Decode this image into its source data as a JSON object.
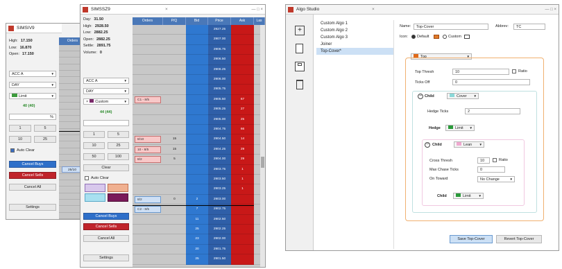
{
  "left_window": {
    "title": "SIMSIV9",
    "stats": [
      {
        "label": "High:",
        "value": "17.150"
      },
      {
        "label": "Low:",
        "value": "16.870"
      },
      {
        "label": "Open:",
        "value": "17.150"
      }
    ],
    "account": "ACC A",
    "qty_mode": "DAY",
    "order_type": "Limit",
    "qty_display": "40 (40)",
    "qty_unit": "%",
    "qty_buttons": [
      "1",
      "5",
      "10",
      "25"
    ],
    "auto_clear": "Auto Clear",
    "cancel_buys": "Cancel Buys",
    "cancel_sells": "Cancel Sells",
    "cancel_all": "Cancel All",
    "settings": "Settings",
    "col_orders": "Orders",
    "order_tag": "25/10"
  },
  "mid_window": {
    "title": "SIMSSZ9",
    "stats": [
      {
        "label": "Day:",
        "value": "31.50"
      },
      {
        "label": "High:",
        "value": "2928.50"
      },
      {
        "label": "Low:",
        "value": "2882.25"
      },
      {
        "label": "Open:",
        "value": "2882.25"
      },
      {
        "label": "Settle:",
        "value": "2891.75"
      },
      {
        "label": "Volume:",
        "value": "0"
      }
    ],
    "account": "ACC A",
    "qty_mode": "DAY",
    "custom_label": "Custom",
    "qty_display": "44 (44)",
    "qty_buttons": [
      "1",
      "5",
      "10",
      "25",
      "50",
      "100"
    ],
    "clear": "Clear",
    "auto_clear": "Auto Clear",
    "cancel_buys": "Cancel Buys",
    "cancel_sells": "Cancel Sells",
    "cancel_all": "Cancel All",
    "settings": "Settings",
    "columns": [
      "Orders",
      "P/Q",
      "Bid",
      "Price",
      "Ask",
      "Las"
    ],
    "prices": [
      "2927.25",
      "2907.00",
      "2906.75",
      "2906.50",
      "2906.25",
      "2906.00",
      "2905.75",
      "2905.50",
      "2905.25",
      "2905.00",
      "2904.75",
      "2904.50",
      "2904.25",
      "2904.00",
      "2903.75",
      "2903.50",
      "2903.25",
      "2903.00",
      "2902.75",
      "2902.50",
      "2902.25",
      "2902.00",
      "2901.75",
      "2901.50"
    ],
    "ask_values": [
      "",
      "",
      "",
      "",
      "",
      "",
      "",
      "67",
      "27",
      "25",
      "66",
      "14",
      "29",
      "29",
      "1",
      "1",
      "1",
      "",
      "",
      "",
      "",
      "",
      "",
      ""
    ],
    "bid_values": [
      "",
      "",
      "",
      "",
      "",
      "",
      "",
      "",
      "",
      "",
      "",
      "",
      "",
      "",
      "",
      "",
      "",
      "2",
      "7",
      "11",
      "25",
      "23",
      "20",
      "25"
    ],
    "pq_values": [
      "",
      "",
      "",
      "",
      "",
      "",
      "",
      "",
      "",
      "",
      "",
      "15",
      "15",
      "5",
      "",
      "",
      "",
      "0",
      "",
      "",
      "",
      "",
      "",
      ""
    ],
    "order_tags": [
      {
        "row": 7,
        "text": "C1 - 8/5"
      },
      {
        "row": 11,
        "text": "8/10"
      },
      {
        "row": 12,
        "text": "10 - 8/5"
      },
      {
        "row": 13,
        "text": "8/2"
      },
      {
        "row": 17,
        "text": "8/2"
      },
      {
        "row": 18,
        "text": "C2 - 8/5"
      }
    ]
  },
  "algo_studio": {
    "title": "Algo Studio",
    "list": [
      "Custom Algo 1",
      "Custom Algo 2",
      "Custom Algo 3",
      "Joiner",
      "Top-Cover*"
    ],
    "name_label": "Name:",
    "name_value": "Top-Cover",
    "abbrev_label": "Abbrev:",
    "abbrev_value": "TC",
    "icon_label": "Icon:",
    "default_label": "Default",
    "custom_label": "Custom",
    "top_select": "Top",
    "top_thresh_label": "Top Thresh",
    "top_thresh_value": "10",
    "ratio_label": "Ratio",
    "ticks_off_label": "Ticks Off",
    "ticks_off_value": "0",
    "child_label": "Child",
    "cover_select": "Cover",
    "hedge_ticks_label": "Hedge Ticks",
    "hedge_ticks_value": "2",
    "hedge_label": "Hedge",
    "hedge_select": "Limit",
    "lean_select": "Lean",
    "cross_thresh_label": "Cross Thresh",
    "cross_thresh_value": "10",
    "max_chase_label": "Max Chase Ticks",
    "max_chase_value": "0",
    "on_toward_label": "On Toward",
    "on_toward_value": "No Change",
    "inner_child_select": "Limit",
    "save_button": "Save Top-Cover",
    "revert_button": "Revert Top-Cover",
    "colors": {
      "accent": "#f0b070",
      "select_blue": "#cce0f5"
    }
  }
}
